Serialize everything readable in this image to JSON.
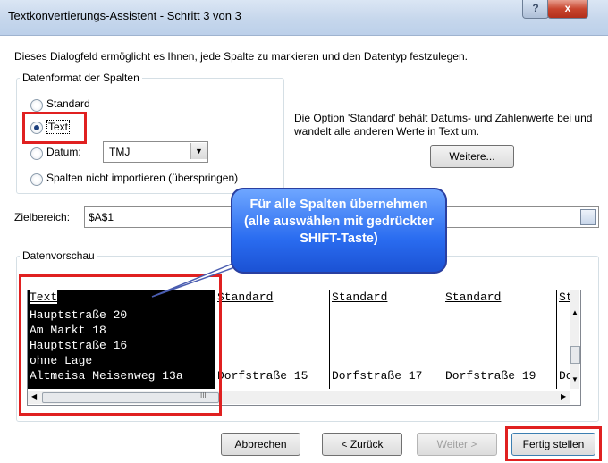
{
  "window": {
    "title": "Textkonvertierungs-Assistent - Schritt 3 von 3",
    "help_glyph": "?",
    "close_glyph": "x"
  },
  "description": "Dieses Dialogfeld ermöglicht es Ihnen, jede Spalte zu markieren und den Datentyp festzulegen.",
  "format_group": {
    "label": "Datenformat der Spalten",
    "standard_label": "Standard",
    "text_label": "Text",
    "datum_label": "Datum:",
    "datum_value": "TMJ",
    "skip_label": "Spalten nicht importieren (überspringen)",
    "selected": "Text"
  },
  "info_text": "Die Option 'Standard' behält Datums- und Zahlenwerte bei und wandelt alle anderen Werte in Text um.",
  "weitere_button": "Weitere...",
  "zielbereich": {
    "label": "Zielbereich:",
    "value": "$A$1"
  },
  "callout_text": "Für alle Spalten übernehmen (alle auswählen mit gedrückter SHIFT-Taste)",
  "preview": {
    "label": "Datenvorschau",
    "columns": [
      {
        "header": "Text",
        "cells": [
          "Hauptstraße 20",
          "Am Markt 18",
          "Hauptstraße 16",
          "ohne Lage",
          "Altmeisa Meisenweg 13a"
        ]
      },
      {
        "header": "Standard",
        "cells": [
          "",
          "",
          "",
          "",
          "Dorfstraße 15"
        ]
      },
      {
        "header": "Standard",
        "cells": [
          "",
          "",
          "",
          "",
          "Dorfstraße 17"
        ]
      },
      {
        "header": "Standard",
        "cells": [
          "",
          "",
          "",
          "",
          "Dorfstraße 19"
        ]
      },
      {
        "header": "St",
        "cells": [
          "",
          "",
          "",
          "",
          "Do"
        ]
      }
    ],
    "scroll_grip": "III"
  },
  "buttons": {
    "cancel": "Abbrechen",
    "back": "< Zurück",
    "next": "Weiter >",
    "finish": "Fertig stellen"
  }
}
